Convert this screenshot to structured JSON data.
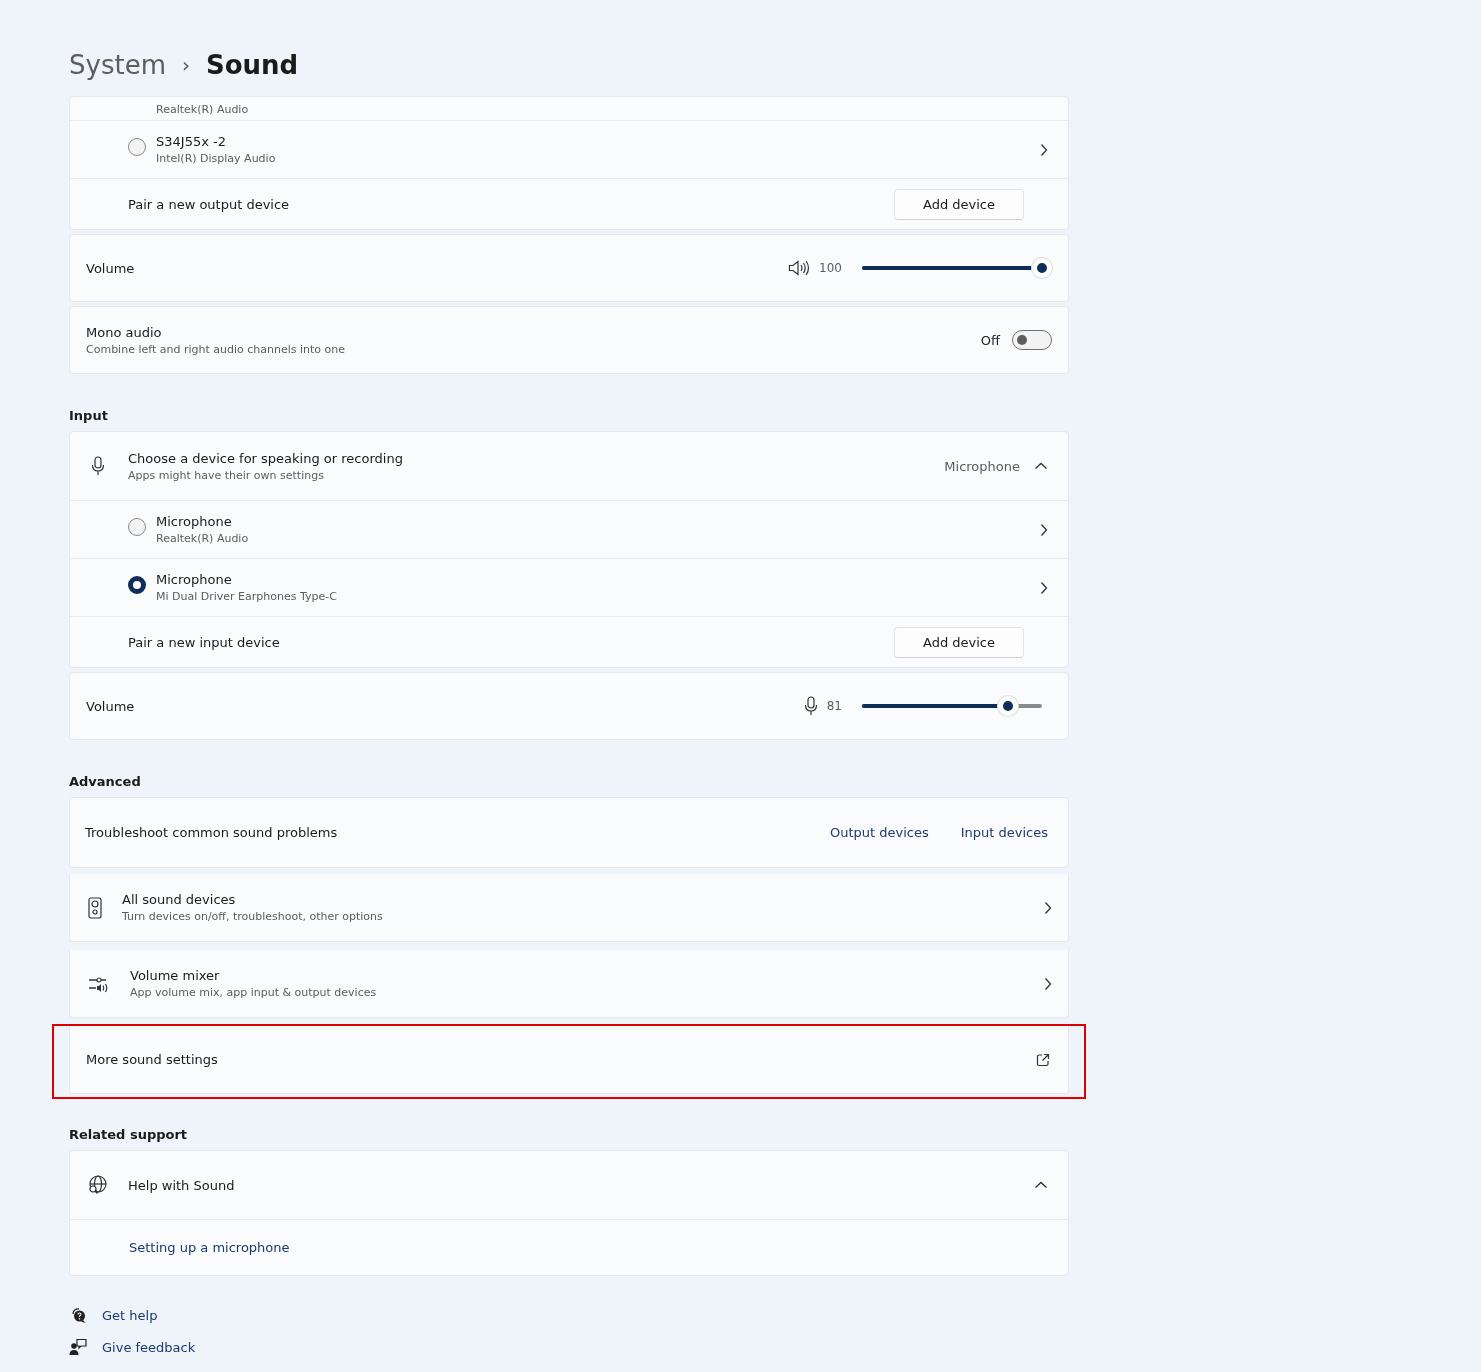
{
  "breadcrumb": {
    "parent": "System",
    "separator": "›",
    "current": "Sound"
  },
  "output": {
    "devices": [
      {
        "kind": "partial",
        "subtitle": "Realtek(R) Audio"
      },
      {
        "kind": "device",
        "name": "S34J55x -2",
        "subtitle": "Intel(R) Display Audio",
        "selected": false
      }
    ],
    "pair": {
      "label": "Pair a new output device",
      "button": "Add device"
    },
    "volume": {
      "label": "Volume",
      "reading": "100",
      "level": 1.0
    },
    "mono": {
      "title": "Mono audio",
      "subtitle": "Combine left and right audio channels into one",
      "state_label": "Off",
      "on": false
    }
  },
  "input": {
    "heading": "Input",
    "chooser": {
      "title": "Choose a device for speaking or recording",
      "subtitle": "Apps might have their own settings",
      "value": "Microphone",
      "expanded": true
    },
    "devices": [
      {
        "kind": "device",
        "name": "Microphone",
        "subtitle": "Realtek(R) Audio",
        "selected": false
      },
      {
        "kind": "device",
        "name": "Microphone",
        "subtitle": "Mi Dual Driver Earphones Type-C",
        "selected": true
      }
    ],
    "pair": {
      "label": "Pair a new input device",
      "button": "Add device"
    },
    "volume": {
      "label": "Volume",
      "reading": "81",
      "level": 0.81
    }
  },
  "advanced": {
    "heading": "Advanced",
    "troubleshoot": {
      "label": "Troubleshoot common sound problems",
      "links": [
        "Output devices",
        "Input devices"
      ]
    },
    "items": [
      {
        "kind": "speaker",
        "title": "All sound devices",
        "subtitle": "Turn devices on/off, troubleshoot, other options",
        "external": false,
        "highlighted": false
      },
      {
        "kind": "mixer",
        "title": "Volume mixer",
        "subtitle": "App volume mix, app input & output devices",
        "external": false,
        "highlighted": false
      },
      {
        "kind": "plain",
        "title": "More sound settings",
        "external": true,
        "highlighted": true
      }
    ]
  },
  "related": {
    "heading": "Related support",
    "help": {
      "title": "Help with Sound",
      "expanded": true,
      "links": [
        "Setting up a microphone"
      ]
    }
  },
  "footer": [
    {
      "kind": "help",
      "label": "Get help"
    },
    {
      "kind": "feedback",
      "label": "Give feedback"
    }
  ]
}
